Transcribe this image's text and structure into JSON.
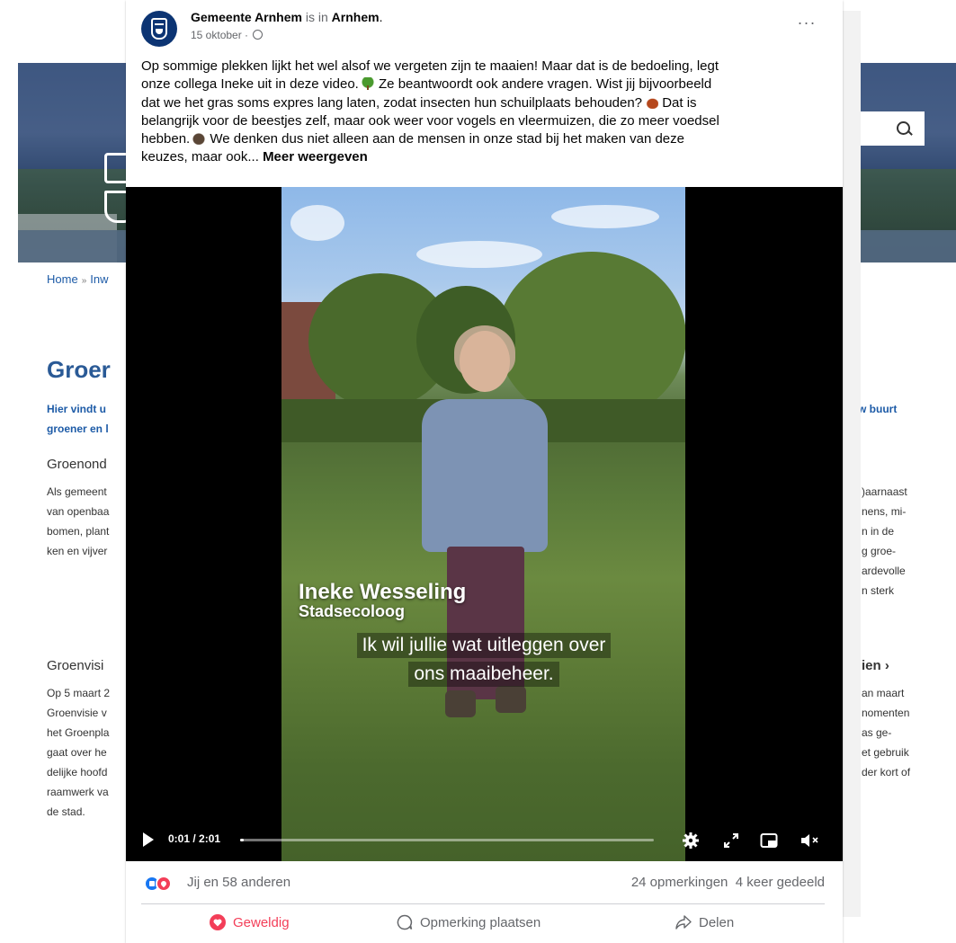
{
  "background_page": {
    "breadcrumb": {
      "home": "Home",
      "sep": "»",
      "partial": "Inw"
    },
    "title_partial": "Groer",
    "intro_left": [
      "Hier vindt u",
      "groener en l"
    ],
    "intro_right": "w buurt",
    "section1_title_partial": "Groenond",
    "section1_left": [
      "Als gemeent",
      "van openbaa",
      "bomen, plant",
      "ken en vijver"
    ],
    "section1_right": [
      ")aarnaast",
      "nens, mi-",
      "n in de",
      "g groe-",
      "ardevolle",
      "n sterk"
    ],
    "section2_title_left": "Groenvisi",
    "section2_title_right": "ien ›",
    "section2_left": [
      "Op 5 maart 2",
      "Groenvisie v",
      "het Groenpla",
      "gaat over he",
      "delijke hoofd",
      "raamwerk va",
      "de stad."
    ],
    "section2_right": [
      "an maart",
      "nomenten",
      "as ge-",
      "et gebruik",
      "der kort of"
    ]
  },
  "post": {
    "author": "Gemeente Arnhem",
    "is_in": "is in",
    "location": "Arnhem",
    "location_punct": ".",
    "date": "15 oktober ·",
    "more": "···",
    "text_lines": [
      "Op sommige plekken lijkt het wel alsof we vergeten zijn te maaien! Maar dat is de bedoeling, legt",
      "onze collega Ineke uit in deze video.",
      "Ze beantwoordt ook andere vragen. Wist jij bijvoorbeeld",
      "dat we het gras soms expres lang laten, zodat insecten hun schuilplaats behouden?",
      "Dat is",
      "belangrijk voor de beestjes zelf, maar ook weer voor vogels en vleermuizen, die zo meer voedsel",
      "hebben.",
      "We denken dus niet alleen aan de mensen in onze stad bij het maken van deze",
      "keuzes, maar ook... "
    ],
    "see_more": "Meer weergeven",
    "video": {
      "name": "Ineke Wesseling",
      "role": "Stadsecoloog",
      "subtitle_1": "Ik wil jullie wat uitleggen over",
      "subtitle_2": "ons maaibeheer.",
      "time": "0:01 / 2:01",
      "progress": 0.008
    },
    "reactions_text": "Jij en 58 anderen",
    "comments_count": "24 opmerkingen",
    "shares_count": "4 keer gedeeld",
    "action_love": "Geweldig",
    "action_comment": "Opmerking plaatsen",
    "action_share": "Delen"
  },
  "colors": {
    "brand_blue": "#0c3473",
    "link_blue": "#1d5ba7",
    "love_red": "#f33e58",
    "like_blue": "#1877f2"
  }
}
